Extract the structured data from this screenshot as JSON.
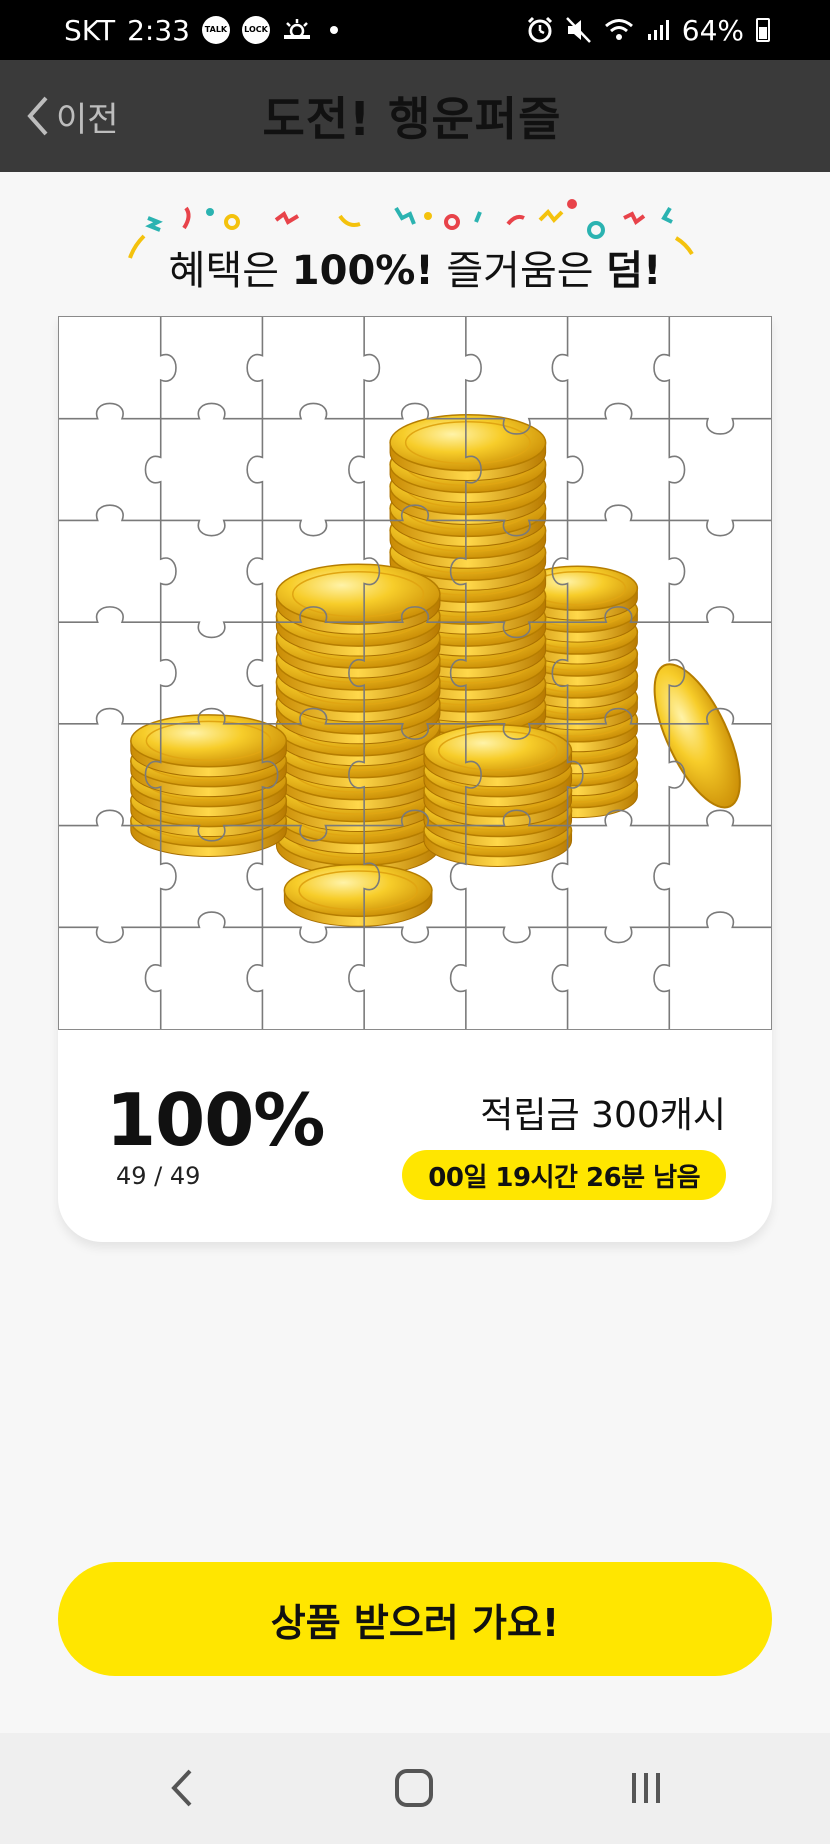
{
  "status_bar": {
    "carrier": "SKT",
    "time": "2:33",
    "talk_icon_label": "TALK",
    "lock_icon_label": "LOCK",
    "battery": "64%"
  },
  "header": {
    "back_label": "이전",
    "title": "도전! 행운퍼즐"
  },
  "banner": {
    "text_1": "혜택은 ",
    "text_2": "100%!",
    "text_3": " 즐거움은 ",
    "text_4": "덤!"
  },
  "card": {
    "percent": "100%",
    "count": "49 / 49",
    "reward": "적립금 300캐시",
    "remaining": "00일 19시간 26분 남음",
    "progress_fraction": 1.0,
    "pieces_done": 49,
    "pieces_total": 49
  },
  "cta_label": "상품 받으러 가요!",
  "colors": {
    "accent": "#ffe600",
    "header_bg": "#3a3a3a",
    "coin_gold": "#f5c518"
  },
  "icons": [
    "alarm-icon",
    "mute-icon",
    "wifi-icon",
    "signal-icon",
    "battery-icon",
    "back-chevron-icon",
    "coin-stack-image"
  ]
}
